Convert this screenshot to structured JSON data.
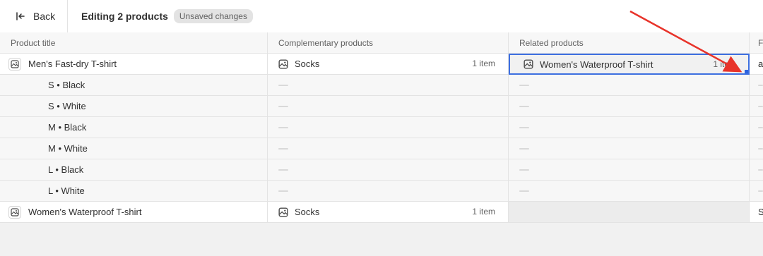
{
  "header": {
    "back_label": "Back",
    "title": "Editing 2 products",
    "badge": "Unsaved changes"
  },
  "columns": {
    "product_title": "Product title",
    "complementary": "Complementary products",
    "related": "Related products",
    "next": "F"
  },
  "rows": {
    "p1": {
      "title": "Men's Fast-dry T-shirt",
      "complementary": "Socks",
      "complementary_count": "1 item",
      "related": "Women's Waterproof T-shirt",
      "related_count": "1 item",
      "next": "a"
    },
    "variants": [
      "S • Black",
      "S • White",
      "M • Black",
      "M • White",
      "L • Black",
      "L • White"
    ],
    "p2": {
      "title": "Women's Waterproof T-shirt",
      "complementary": "Socks",
      "complementary_count": "1 item",
      "next": "S"
    }
  },
  "annotation": {
    "color": "#e8332a"
  }
}
